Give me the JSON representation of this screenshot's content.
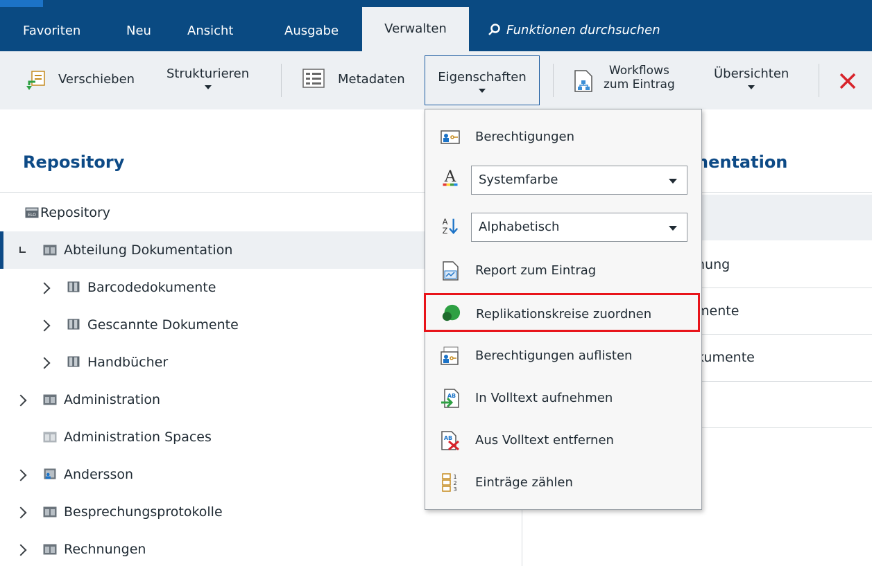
{
  "menubar": {
    "tabs": [
      "Favoriten",
      "Neu",
      "Ansicht",
      "Ausgabe",
      "Verwalten"
    ],
    "search_placeholder": "Funktionen durchsuchen"
  },
  "ribbon": {
    "verschieben": "Verschieben",
    "strukturieren": "Strukturieren",
    "metadaten": "Metadaten",
    "eigenschaften": "Eigenschaften",
    "workflows_line1": "Workflows",
    "workflows_line2": "zum Eintrag",
    "uebersichten": "Übersichten"
  },
  "left_panel": {
    "title": "Repository",
    "rows": [
      {
        "label": "Repository"
      },
      {
        "label": "Abteilung Dokumentation"
      },
      {
        "label": "Barcodedokumente"
      },
      {
        "label": "Gescannte Dokumente"
      },
      {
        "label": "Handbücher"
      },
      {
        "label": "Administration"
      },
      {
        "label": "Administration Spaces"
      },
      {
        "label": "Andersson"
      },
      {
        "label": "Besprechungsprotokolle"
      },
      {
        "label": "Rechnungen"
      }
    ]
  },
  "right_panel": {
    "title_partial": "nentation",
    "rows": [
      "hung",
      "mente",
      "kumente"
    ]
  },
  "menu": {
    "berechtigungen": "Berechtigungen",
    "color_value": "Systemfarbe",
    "sort_value": "Alphabetisch",
    "report": "Report zum Eintrag",
    "replikation": "Replikationskreise zuordnen",
    "berechtigungen_auflisten": "Berechtigungen auflisten",
    "volltext_aufnehmen": "In Volltext aufnehmen",
    "volltext_entfernen": "Aus Volltext entfernen",
    "eintraege_zaehlen": "Einträge zählen"
  },
  "colors": {
    "brand": "#0a4a82",
    "highlight": "#e8141a",
    "replication": "#2ea043"
  }
}
